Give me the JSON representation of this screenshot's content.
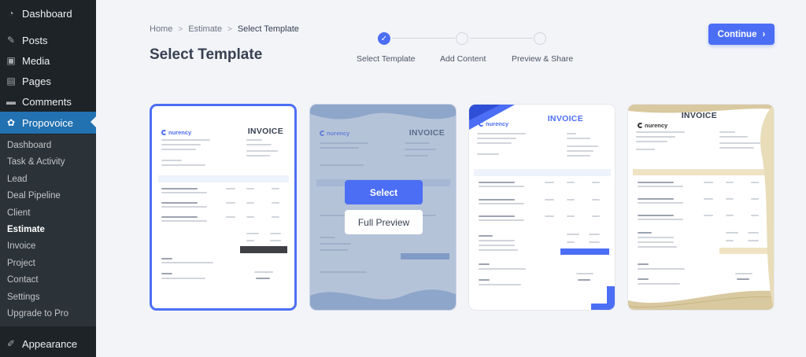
{
  "sidebar": {
    "menu": [
      {
        "label": "Dashboard",
        "icon": "dashboard-icon"
      },
      {
        "label": "Posts",
        "icon": "pin-icon"
      },
      {
        "label": "Media",
        "icon": "media-icon"
      },
      {
        "label": "Pages",
        "icon": "pages-icon"
      },
      {
        "label": "Comments",
        "icon": "comment-icon"
      },
      {
        "label": "Propovoice",
        "icon": "gear-icon"
      }
    ],
    "submenu": [
      "Dashboard",
      "Task & Activity",
      "Lead",
      "Deal Pipeline",
      "Client",
      "Estimate",
      "Invoice",
      "Project",
      "Contact",
      "Settings",
      "Upgrade to Pro"
    ],
    "current_submenu": "Estimate",
    "appearance": {
      "label": "Appearance",
      "icon": "brush-icon"
    }
  },
  "header": {
    "breadcrumb": [
      "Home",
      "Estimate",
      "Select Template"
    ],
    "title": "Select Template",
    "continue_label": "Continue"
  },
  "steps": [
    {
      "label": "Select Template",
      "done": true
    },
    {
      "label": "Add Content",
      "done": false
    },
    {
      "label": "Preview & Share",
      "done": false
    }
  ],
  "templates": {
    "invoice_label": "INVOICE",
    "logo_text": "nurency",
    "select_label": "Select",
    "preview_label": "Full Preview"
  },
  "colors": {
    "accent": "#4c6ef5",
    "sidebar_bg": "#1d2327",
    "active_menu": "#2271b1",
    "gold": "#d9c9a0"
  }
}
